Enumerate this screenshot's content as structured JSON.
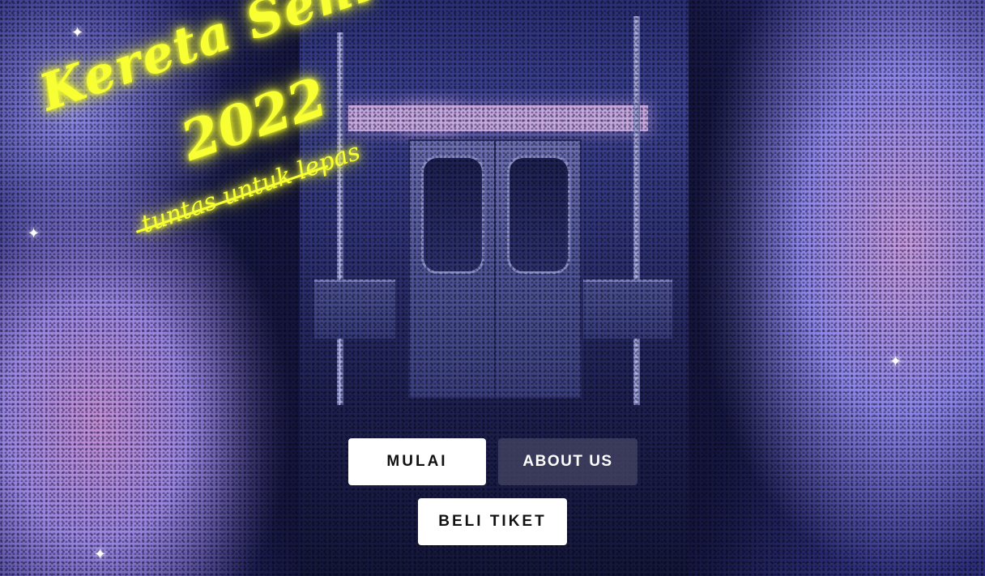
{
  "title": {
    "line1": "Kereta Seni",
    "line2": "2022",
    "tagline": "tuntas untuk lepas"
  },
  "buttons": {
    "start": "MULAI",
    "about": "ABOUT US",
    "ticket": "BELI TIKET"
  },
  "colors": {
    "neon": "#f8ff32",
    "button_light": "#ffffff",
    "button_dark": "#464664"
  },
  "icons": [
    "sparkle-icon"
  ]
}
